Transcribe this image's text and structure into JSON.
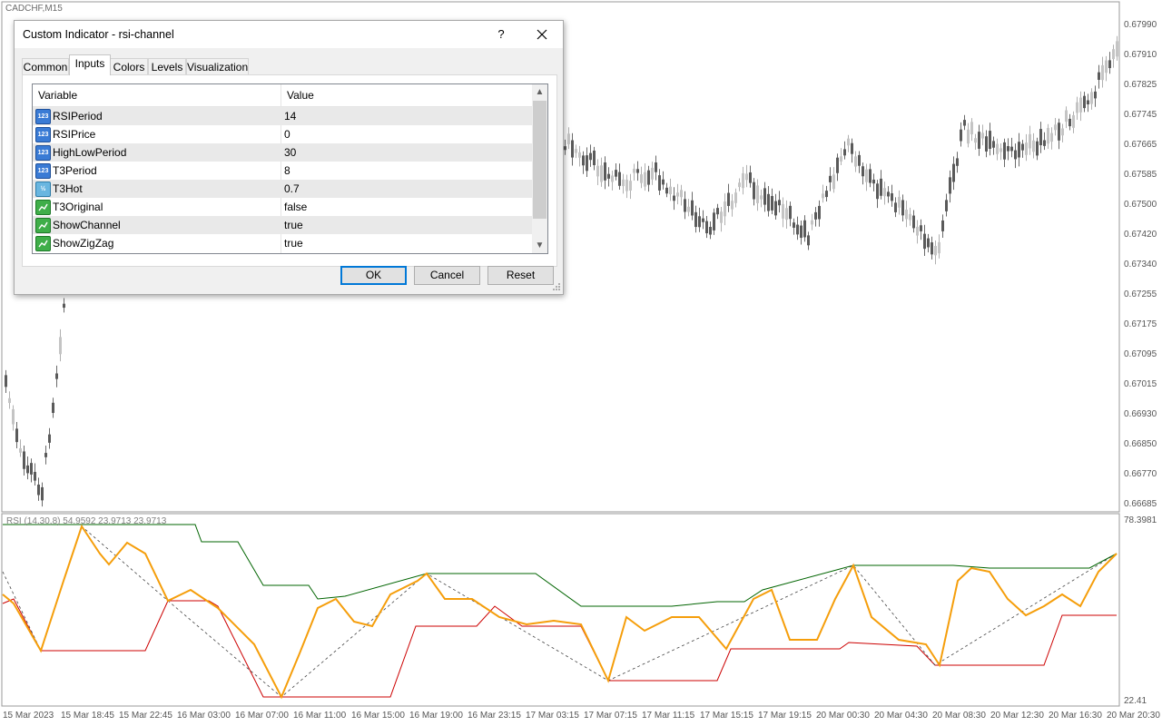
{
  "window": {
    "symbol_title": "CADCHF,M15"
  },
  "price_axis": [
    "0.67990",
    "0.67910",
    "0.67825",
    "0.67745",
    "0.67665",
    "0.67585",
    "0.67500",
    "0.67420",
    "0.67340",
    "0.67255",
    "0.67175",
    "0.67095",
    "0.67015",
    "0.66930",
    "0.66850",
    "0.66770",
    "0.66685"
  ],
  "rsi_panel": {
    "label": "RSI (14,30,8) 54.9592 23.9713 23.9713",
    "scale_max": "78.3981",
    "scale_min": "22.41"
  },
  "time_axis": [
    "15 Mar 2023",
    "15 Mar 18:45",
    "15 Mar 22:45",
    "16 Mar 03:00",
    "16 Mar 07:00",
    "16 Mar 11:00",
    "16 Mar 15:00",
    "16 Mar 19:00",
    "16 Mar 23:15",
    "17 Mar 03:15",
    "17 Mar 07:15",
    "17 Mar 11:15",
    "17 Mar 15:15",
    "17 Mar 19:15",
    "20 Mar 00:30",
    "20 Mar 04:30",
    "20 Mar 08:30",
    "20 Mar 12:30",
    "20 Mar 16:30",
    "20 Mar 20:30"
  ],
  "dialog": {
    "title": "Custom Indicator - rsi-channel",
    "help": "?",
    "tabs": [
      "Common",
      "Inputs",
      "Colors",
      "Levels",
      "Visualization"
    ],
    "active_tab": "Inputs",
    "columns": {
      "variable": "Variable",
      "value": "Value"
    },
    "params": [
      {
        "name": "RSIPeriod",
        "value": "14",
        "type": "int",
        "icon": "123"
      },
      {
        "name": "RSIPrice",
        "value": "0",
        "type": "int",
        "icon": "123"
      },
      {
        "name": "HighLowPeriod",
        "value": "30",
        "type": "int",
        "icon": "123"
      },
      {
        "name": "T3Period",
        "value": "8",
        "type": "int",
        "icon": "123"
      },
      {
        "name": "T3Hot",
        "value": "0.7",
        "type": "dbl",
        "icon": "½"
      },
      {
        "name": "T3Original",
        "value": "false",
        "type": "bool",
        "icon": ""
      },
      {
        "name": "ShowChannel",
        "value": "true",
        "type": "bool",
        "icon": ""
      },
      {
        "name": "ShowZigZag",
        "value": "true",
        "type": "bool",
        "icon": ""
      }
    ],
    "buttons": {
      "ok": "OK",
      "cancel": "Cancel",
      "reset": "Reset"
    }
  },
  "colors": {
    "rsi_line": "#f59e0b",
    "channel_upper": "#006400",
    "channel_lower": "#cc0000",
    "zigzag": "#444444"
  }
}
